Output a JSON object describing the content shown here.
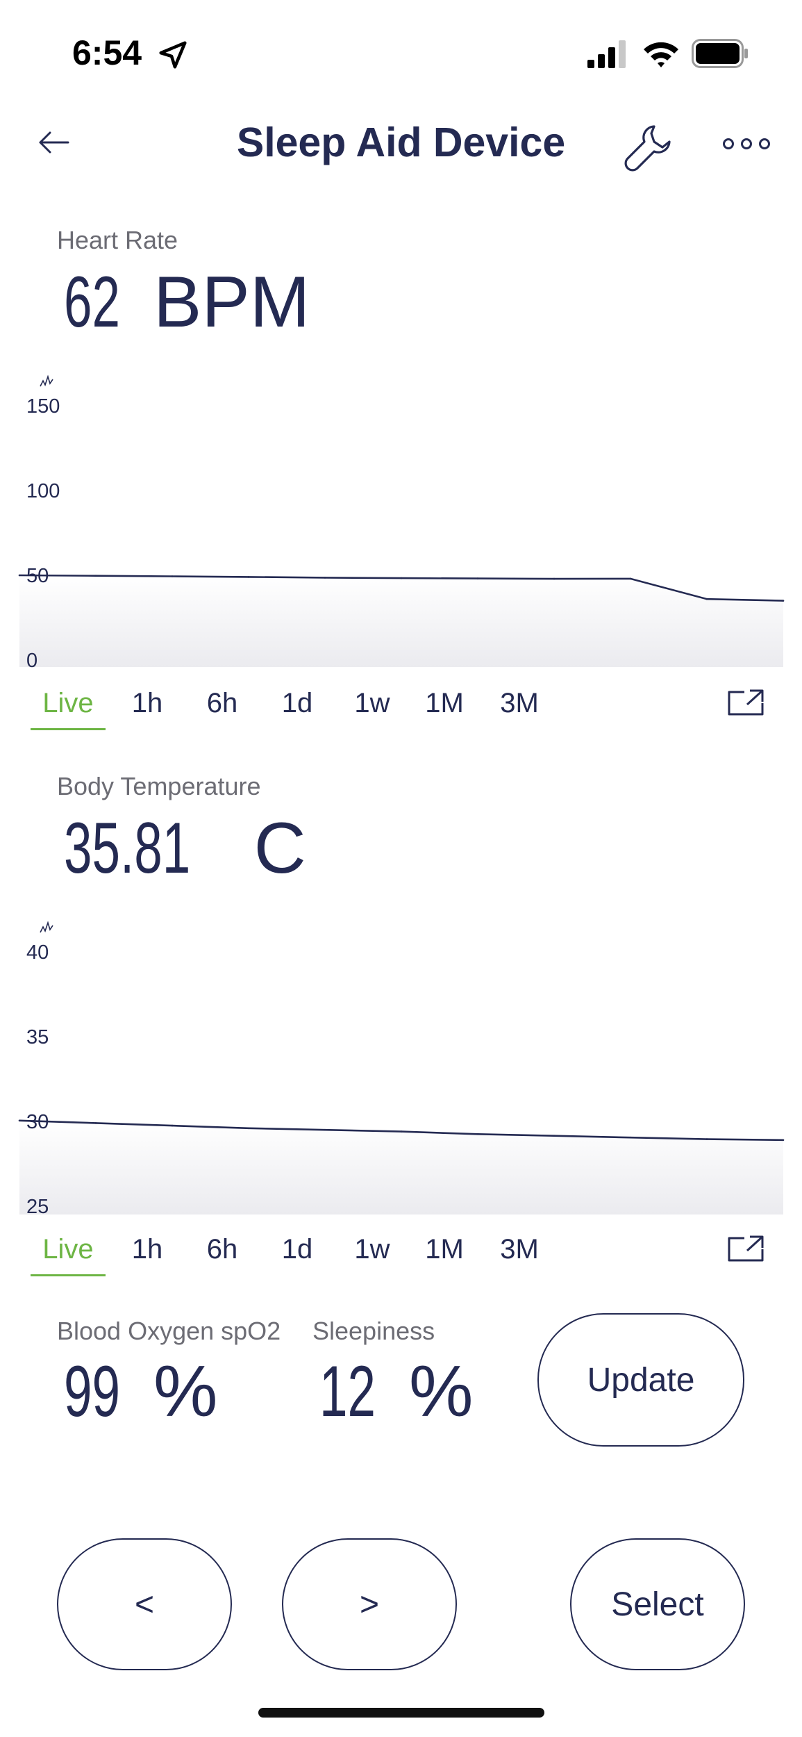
{
  "status_bar": {
    "time": "6:54"
  },
  "header": {
    "title": "Sleep Aid Device"
  },
  "heart_rate": {
    "label": "Heart Rate",
    "value": "62",
    "unit": "BPM"
  },
  "body_temperature": {
    "label": "Body Temperature",
    "value": "35.81",
    "unit": "C"
  },
  "range_tabs": [
    "Live",
    "1h",
    "6h",
    "1d",
    "1w",
    "1M",
    "3M"
  ],
  "active_range": "Live",
  "blood_oxygen": {
    "label": "Blood Oxygen spO2",
    "value": "99",
    "unit": "%"
  },
  "sleepiness": {
    "label": "Sleepiness",
    "value": "12",
    "unit": "%"
  },
  "buttons": {
    "update": "Update",
    "prev": "<",
    "next": ">",
    "select": "Select"
  },
  "colors": {
    "primary": "#242a52",
    "active_tab": "#6db544",
    "label_gray": "#6c6c74"
  },
  "chart_data": [
    {
      "type": "area",
      "title": "",
      "y_ticks": [
        "150",
        "100",
        "50",
        "0"
      ],
      "ylim": [
        0,
        150
      ],
      "grid": false,
      "x": [
        0,
        1,
        2,
        3,
        4,
        5,
        6,
        7,
        8,
        9,
        10
      ],
      "values": [
        50,
        49.7,
        49.4,
        49,
        48.6,
        48.3,
        48.1,
        47.9,
        48,
        36,
        35
      ]
    },
    {
      "type": "area",
      "title": "",
      "y_ticks": [
        "40",
        "35",
        "30",
        "25"
      ],
      "ylim": [
        25,
        40
      ],
      "grid": false,
      "x": [
        0,
        1,
        2,
        3,
        4,
        5,
        6,
        7,
        8,
        9,
        10
      ],
      "values": [
        30.05,
        29.9,
        29.75,
        29.6,
        29.5,
        29.4,
        29.25,
        29.15,
        29.05,
        28.95,
        28.9
      ]
    }
  ]
}
